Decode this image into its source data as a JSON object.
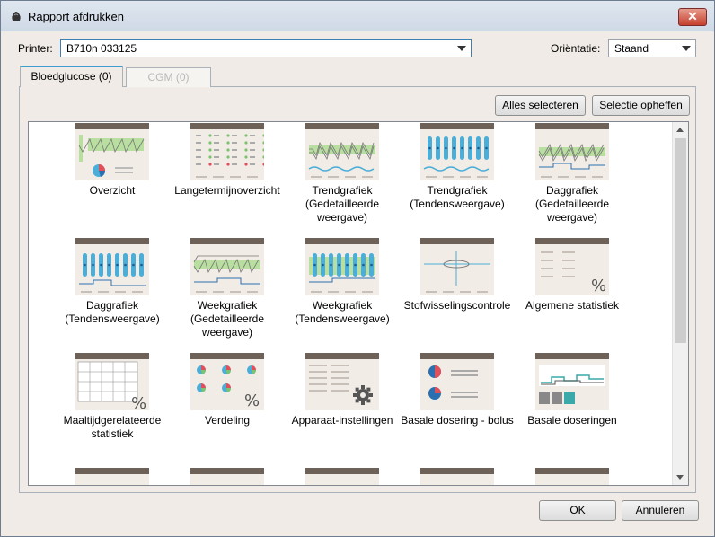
{
  "window": {
    "title": "Rapport afdrukken"
  },
  "printer": {
    "label": "Printer:",
    "value": "B710n 033125"
  },
  "orientation": {
    "label": "Oriëntatie:",
    "value": "Staand"
  },
  "tabs": [
    {
      "label": "Bloedglucose (0)",
      "active": true
    },
    {
      "label": "CGM (0)",
      "active": false
    }
  ],
  "buttons": {
    "select_all": "Alles selecteren",
    "deselect": "Selectie opheffen",
    "ok": "OK",
    "cancel": "Annuleren"
  },
  "reports": [
    {
      "label": "Overzicht",
      "icon": "overview-report-icon"
    },
    {
      "label": "Langetermijnoverzicht",
      "icon": "long-term-report-icon"
    },
    {
      "label": "Trendgrafiek (Gedetailleerde weergave)",
      "icon": "trend-detail-report-icon"
    },
    {
      "label": "Trendgrafiek (Tendensweergave)",
      "icon": "trend-tendency-report-icon"
    },
    {
      "label": "Daggrafiek (Gedetailleerde weergave)",
      "icon": "day-detail-report-icon"
    },
    {
      "label": "Daggrafiek (Tendensweergave)",
      "icon": "day-tendency-report-icon"
    },
    {
      "label": "Weekgrafiek (Gedetailleerde weergave)",
      "icon": "week-detail-report-icon"
    },
    {
      "label": "Weekgrafiek (Tendensweergave)",
      "icon": "week-tendency-report-icon"
    },
    {
      "label": "Stofwisselingscontrole",
      "icon": "metabolic-control-report-icon"
    },
    {
      "label": "Algemene statistiek",
      "icon": "general-statistics-report-icon"
    },
    {
      "label": "Maaltijdgerelateerde statistiek",
      "icon": "meal-statistics-report-icon"
    },
    {
      "label": "Verdeling",
      "icon": "distribution-report-icon"
    },
    {
      "label": "Apparaat-instellingen",
      "icon": "device-settings-report-icon"
    },
    {
      "label": "Basale dosering - bolus",
      "icon": "basal-bolus-report-icon"
    },
    {
      "label": "Basale doseringen",
      "icon": "basal-rates-report-icon"
    }
  ],
  "colors": {
    "accent": "#3c9fd0",
    "thumb_header": "#6e6258",
    "thumb_bg": "#f1ece6",
    "graph_blue": "#4aaed8",
    "graph_green": "#b9dfa0",
    "graph_red": "#e14f5a"
  }
}
